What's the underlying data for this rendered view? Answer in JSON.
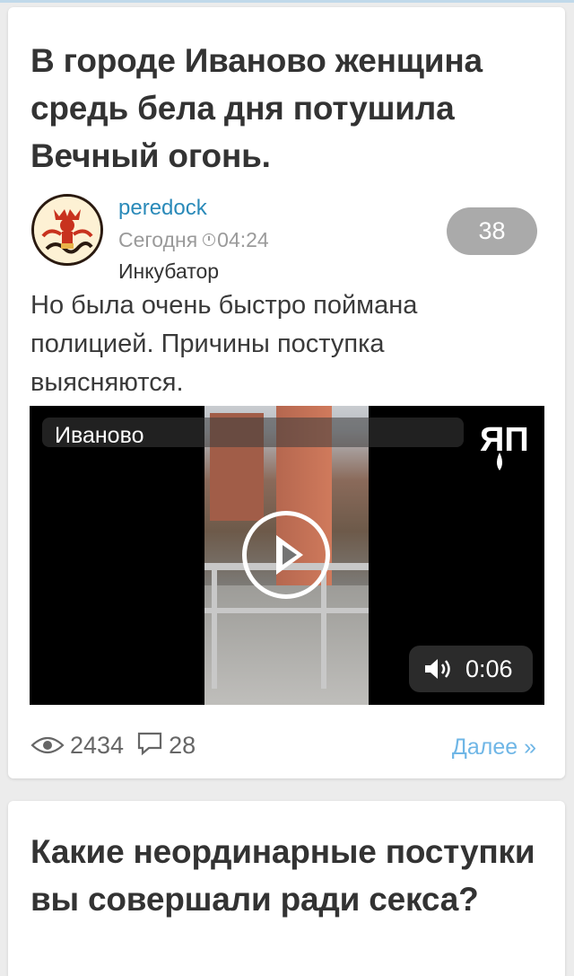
{
  "colors": {
    "accent_link": "#2a8ab9",
    "more_link": "#6fb6e6",
    "rating_badge": "#aaaaaa",
    "background": "#ececec"
  },
  "post": {
    "title": "В городе Иваново женщина средь бела дня потушила Вечный огонь.",
    "author": "peredock",
    "date_label": "Сегодня",
    "time": "04:24",
    "community": "Инкубатор",
    "rating": "38",
    "excerpt": "Но была очень быстро поймана полицией. Причины поступка выясняются.",
    "video": {
      "title": "Иваново",
      "logo": "ЯП",
      "duration": "0:06",
      "play_icon": "play-icon",
      "volume_icon": "volume-icon"
    },
    "views": "2434",
    "comments": "28",
    "more_label": "Далее »"
  },
  "next_post": {
    "title": "Какие неординарные поступки вы совершали ради секса?"
  }
}
